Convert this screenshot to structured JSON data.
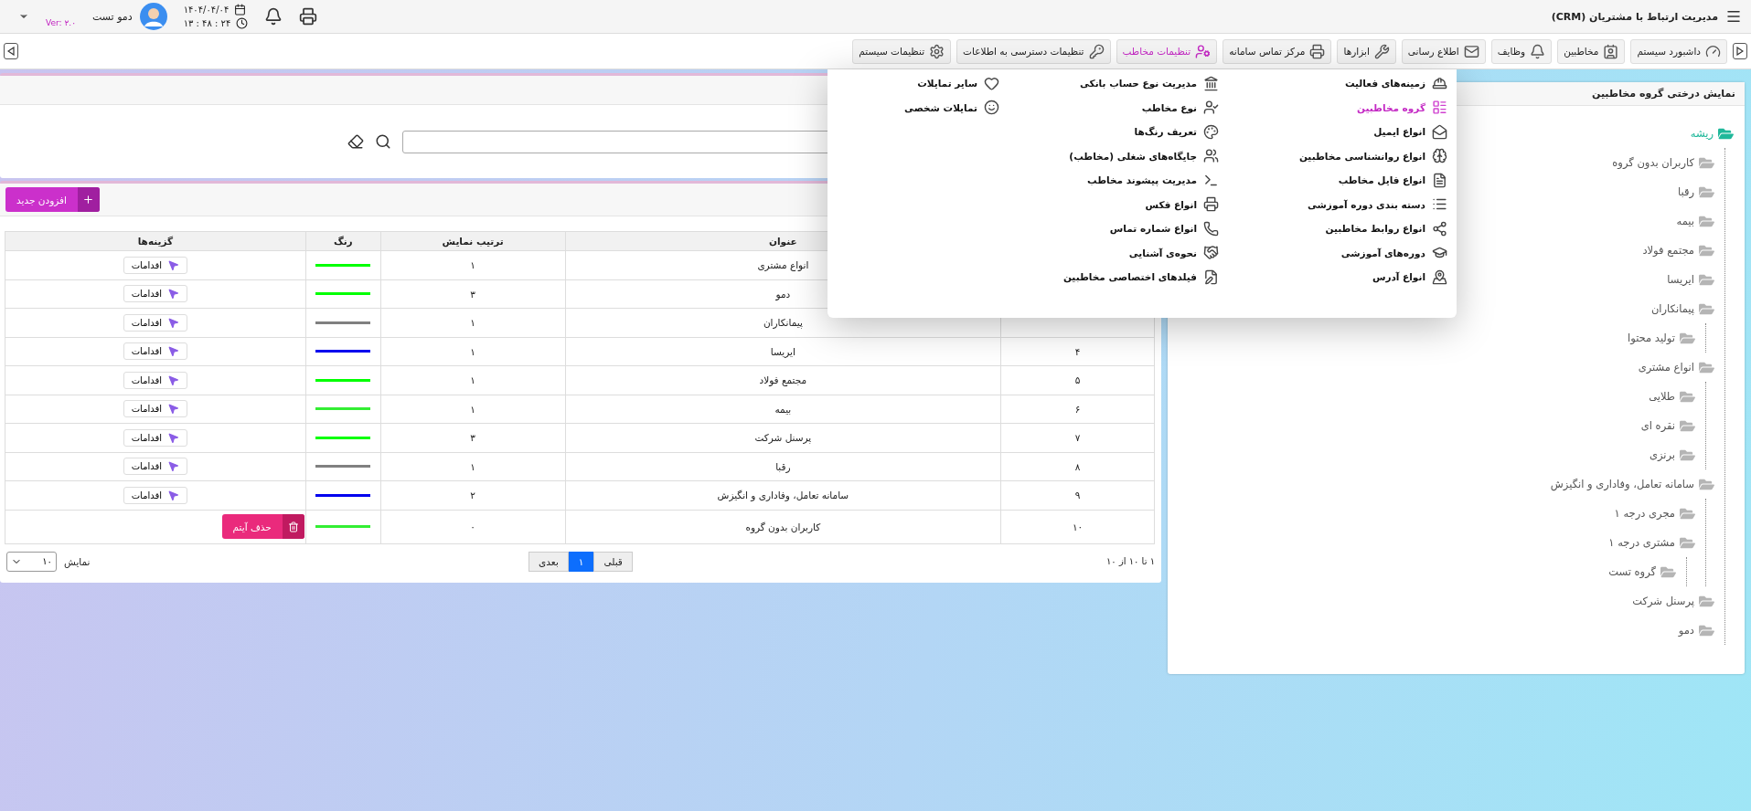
{
  "header": {
    "title": "مدیریت ارتباط با مشتریان (CRM)",
    "date": "۱۴۰۴/۰۴/۰۴",
    "time": "۱۳ : ۴۸ : ۲۴",
    "user": "دمو تست",
    "version": "Ver: ۲.۰"
  },
  "nav": [
    {
      "label": "داشبورد سیستم",
      "selected": false
    },
    {
      "label": "مخاطبین",
      "selected": false
    },
    {
      "label": "وظایف",
      "selected": false
    },
    {
      "label": "اطلاع رسانی",
      "selected": false
    },
    {
      "label": "ابزارها",
      "selected": false
    },
    {
      "label": "مرکز تماس سامانه",
      "selected": false
    },
    {
      "label": "تنظیمات مخاطب",
      "selected": true
    },
    {
      "label": "تنظیمات دسترسی به اطلاعات",
      "selected": false
    },
    {
      "label": "تنظیمات سیستم",
      "selected": false
    }
  ],
  "menu": {
    "columns": [
      [
        {
          "label": "زمینه‌های فعالیت",
          "selected": false
        },
        {
          "label": "گروه مخاطبین",
          "selected": true
        },
        {
          "label": "انواع ایمیل",
          "selected": false
        },
        {
          "label": "انواع روانشناسی مخاطبین",
          "selected": false
        },
        {
          "label": "انواع فایل مخاطب",
          "selected": false
        },
        {
          "label": "دسته بندی دوره آموزشی",
          "selected": false
        },
        {
          "label": "انواع روابط مخاطبین",
          "selected": false
        },
        {
          "label": "دوره‌های آموزشی",
          "selected": false
        },
        {
          "label": "انواع آدرس",
          "selected": false
        }
      ],
      [
        {
          "label": "مدیریت نوع حساب بانکی",
          "selected": false
        },
        {
          "label": "نوع مخاطب",
          "selected": false
        },
        {
          "label": "تعریف رنگ‌ها",
          "selected": false
        },
        {
          "label": "جایگاه‌های شغلی (مخاطب)",
          "selected": false
        },
        {
          "label": "مدیریت پیشوند مخاطب",
          "selected": false
        },
        {
          "label": "انواع فکس",
          "selected": false
        },
        {
          "label": "انواع شماره تماس",
          "selected": false
        },
        {
          "label": "نحوه‌ی آشنایی",
          "selected": false
        },
        {
          "label": "فیلدهای اختصاصی مخاطبین",
          "selected": false
        }
      ],
      [
        {
          "label": "سایر تمایلات",
          "selected": false
        },
        {
          "label": "تمایلات شخصی",
          "selected": false
        }
      ]
    ]
  },
  "toolbar": {
    "add_button": "افزودن جدید"
  },
  "table": {
    "columns": [
      "عنوان",
      "ترتیب نمایش",
      "رنگ",
      "گزینه‌ها"
    ],
    "rows": [
      {
        "title": "انواع مشتری",
        "order": "۱",
        "color": "#00ff00",
        "action": {
          "kind": "menu",
          "label": "اقدامات"
        }
      },
      {
        "title": "دمو",
        "order": "۳",
        "color": "#00ff00",
        "action": {
          "kind": "menu",
          "label": "اقدامات"
        }
      },
      {
        "title": "پیمانکاران",
        "order": "۱",
        "color": "#808080",
        "action": {
          "kind": "menu",
          "label": "اقدامات"
        }
      },
      {
        "index": "۴",
        "title": "ایریسا",
        "order": "۱",
        "color": "#0000ee",
        "action": {
          "kind": "menu",
          "label": "اقدامات"
        }
      },
      {
        "index": "۵",
        "title": "مجتمع فولاد",
        "order": "۱",
        "color": "#00ff00",
        "action": {
          "kind": "menu",
          "label": "اقدامات"
        }
      },
      {
        "index": "۶",
        "title": "بیمه",
        "order": "۱",
        "color": "#33ee33",
        "action": {
          "kind": "menu",
          "label": "اقدامات"
        }
      },
      {
        "index": "۷",
        "title": "پرسنل شرکت",
        "order": "۳",
        "color": "#00ff00",
        "action": {
          "kind": "menu",
          "label": "اقدامات"
        }
      },
      {
        "index": "۸",
        "title": "رقبا",
        "order": "۱",
        "color": "#808080",
        "action": {
          "kind": "menu",
          "label": "اقدامات"
        }
      },
      {
        "index": "۹",
        "title": "سامانه تعامل، وفاداری و انگیزش",
        "order": "۲",
        "color": "#0000ee",
        "action": {
          "kind": "menu",
          "label": "اقدامات"
        }
      },
      {
        "index": "۱۰",
        "title": "کاربران بدون گروه",
        "order": "۰",
        "color": "#33ee33",
        "action": {
          "kind": "delete",
          "label": "حذف آیتم"
        }
      }
    ]
  },
  "pagination": {
    "summary": "۱ تا ۱۰ از ۱۰",
    "pages": [
      {
        "label": "قبلی",
        "selected": false
      },
      {
        "label": "۱",
        "selected": true
      },
      {
        "label": "بعدی",
        "selected": false
      }
    ],
    "page_size_label": "نمایش",
    "page_size": "۱۰"
  },
  "tree": {
    "title": "نمایش درختی گروه مخاطبین",
    "root": {
      "label": "ریشه",
      "selected": true,
      "children": [
        {
          "label": "کاربران بدون گروه",
          "selected": false
        },
        {
          "label": "رقبا",
          "selected": false
        },
        {
          "label": "بیمه",
          "selected": false
        },
        {
          "label": "مجتمع فولاد",
          "selected": false
        },
        {
          "label": "ایریسا",
          "selected": false
        },
        {
          "label": "پیمانکاران",
          "selected": false,
          "children": [
            {
              "label": "تولید محتوا",
              "selected": false
            }
          ]
        },
        {
          "label": "انواع مشتری",
          "selected": false,
          "children": [
            {
              "label": "طلایی",
              "selected": false
            },
            {
              "label": "نقره ای",
              "selected": false
            },
            {
              "label": "برنزی",
              "selected": false
            }
          ]
        },
        {
          "label": "سامانه تعامل، وفاداری و انگیزش",
          "selected": false,
          "children": [
            {
              "label": "مجری درجه ۱",
              "selected": false
            },
            {
              "label": "مشتری درجه ۱",
              "selected": false,
              "children": [
                {
                  "label": "گروه تست",
                  "selected": false
                }
              ]
            }
          ]
        },
        {
          "label": "پرسنل شرکت",
          "selected": false
        },
        {
          "label": "دمو",
          "selected": false
        }
      ]
    }
  }
}
